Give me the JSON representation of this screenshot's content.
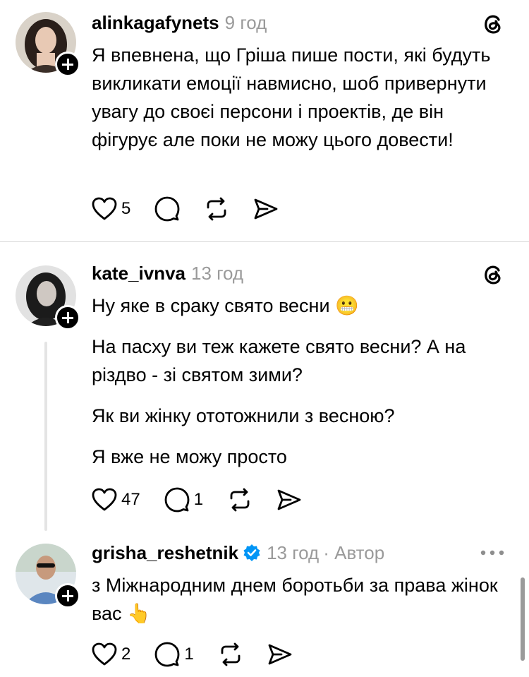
{
  "posts": [
    {
      "username": "alinkagafynets",
      "time": "9 год",
      "paragraphs": [
        "Я впевнена, що Гріша пише пости, які будуть викликати емоції навмисно, шоб привернути увагу до своєі персони і проектів, де він фігурує але поки не можу цього довести!"
      ],
      "likes": "5",
      "replies": "",
      "icons": {
        "top_right": "threads-logo-icon"
      }
    },
    {
      "username": "kate_ivnva",
      "time": "13 год",
      "paragraphs": [
        "Ну яке в сраку свято весни 😬",
        "На пасху ви теж кажете свято весни? А на різдво - зі святом зими?",
        "Як ви жінку ототожнили з весною?",
        "Я вже не можу просто"
      ],
      "likes": "47",
      "replies": "1",
      "icons": {
        "top_right": "threads-logo-icon"
      }
    },
    {
      "username": "grisha_reshetnik",
      "time": "13 год",
      "author_label": "· Автор",
      "paragraphs": [
        "з Міжнародним днем боротьби за права жінок вас 👆"
      ],
      "likes": "2",
      "replies": "1",
      "verified": true,
      "icons": {
        "top_right": "more-dots-icon"
      }
    }
  ],
  "colors": {
    "meta_gray": "#9a9a9a",
    "verified_blue": "#0095f6",
    "divider": "#d8d8d8"
  }
}
